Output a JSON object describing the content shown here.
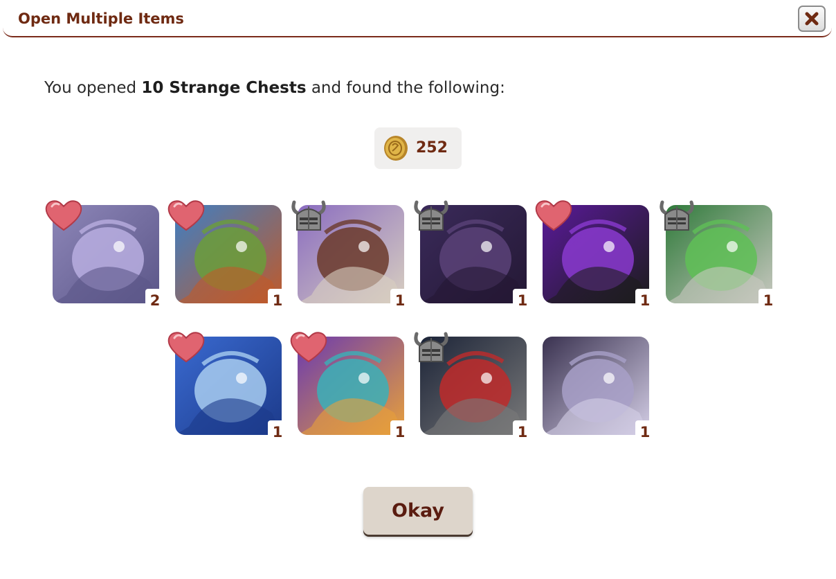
{
  "dialog": {
    "title": "Open Multiple Items",
    "close_icon": "close-icon"
  },
  "intro": {
    "prefix": "You opened ",
    "count_item": "10 Strange Chests",
    "suffix": " and found the following:"
  },
  "treasure": {
    "icon": "coin-icon",
    "amount": "252"
  },
  "items": [
    {
      "quantity": "2",
      "badge": "heart-icon",
      "palette": [
        "#8d86b8",
        "#b9aee0",
        "#5b5688"
      ]
    },
    {
      "quantity": "1",
      "badge": "heart-icon",
      "palette": [
        "#3e7fc4",
        "#6b9e3a",
        "#c05a2a"
      ]
    },
    {
      "quantity": "1",
      "badge": "helmet-icon",
      "palette": [
        "#8a6cc0",
        "#6b3a2a",
        "#d8cfc0"
      ]
    },
    {
      "quantity": "1",
      "badge": "helmet-icon",
      "palette": [
        "#3a2a5a",
        "#5a4278",
        "#241834"
      ]
    },
    {
      "quantity": "1",
      "badge": "heart-icon",
      "palette": [
        "#5a1a9a",
        "#8a3acf",
        "#1c1c1c"
      ]
    },
    {
      "quantity": "1",
      "badge": "helmet-icon",
      "palette": [
        "#2f7a3a",
        "#5fbf56",
        "#c8c8c0"
      ]
    },
    {
      "quantity": "1",
      "badge": "heart-icon",
      "palette": [
        "#3a6ad0",
        "#a8cdf0",
        "#1c3a8a"
      ]
    },
    {
      "quantity": "1",
      "badge": "heart-icon",
      "palette": [
        "#6a3ab0",
        "#3ab0b8",
        "#e8a03a"
      ]
    },
    {
      "quantity": "1",
      "badge": "helmet-icon",
      "palette": [
        "#1c2438",
        "#c02a2a",
        "#7a7a7a"
      ]
    },
    {
      "quantity": "1",
      "badge": "none",
      "palette": [
        "#3a3250",
        "#a8a0c8",
        "#d4cee6"
      ]
    }
  ],
  "okay_label": "Okay"
}
